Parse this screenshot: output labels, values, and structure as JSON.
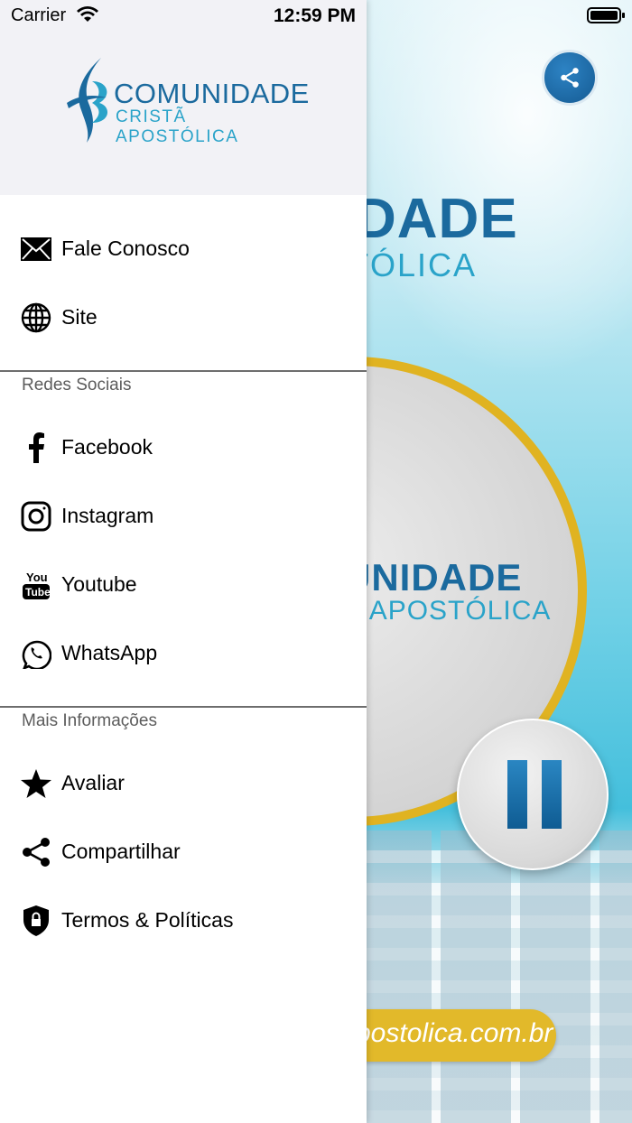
{
  "status_bar": {
    "carrier": "Carrier",
    "time": "12:59 PM"
  },
  "logo": {
    "line1": "COMUNIDADE",
    "line2": "CRISTÃ APOSTÓLICA"
  },
  "menu": {
    "top_items": [
      {
        "label": "Fale Conosco",
        "icon": "envelope-icon"
      },
      {
        "label": "Site",
        "icon": "globe-icon"
      }
    ],
    "social_title": "Redes Sociais",
    "social_items": [
      {
        "label": "Facebook",
        "icon": "facebook-icon"
      },
      {
        "label": "Instagram",
        "icon": "instagram-icon"
      },
      {
        "label": "Youtube",
        "icon": "youtube-icon"
      },
      {
        "label": "WhatsApp",
        "icon": "whatsapp-icon"
      }
    ],
    "info_title": "Mais Informações",
    "info_items": [
      {
        "label": "Avaliar",
        "icon": "star-icon"
      },
      {
        "label": "Compartilhar",
        "icon": "share-icon"
      },
      {
        "label": "Termos & Políticas",
        "icon": "shield-lock-icon"
      }
    ]
  },
  "background": {
    "brand_line1": "NIDADE",
    "brand_line2": "OSTÓLICA",
    "circle_line1": "UNIDADE",
    "circle_line2": "Ã APOSTÓLICA",
    "site_text": "postolica.com.br"
  },
  "colors": {
    "accent_blue": "#1b6a9e",
    "light_blue": "#2aa3c9",
    "gold": "#e0b321"
  }
}
